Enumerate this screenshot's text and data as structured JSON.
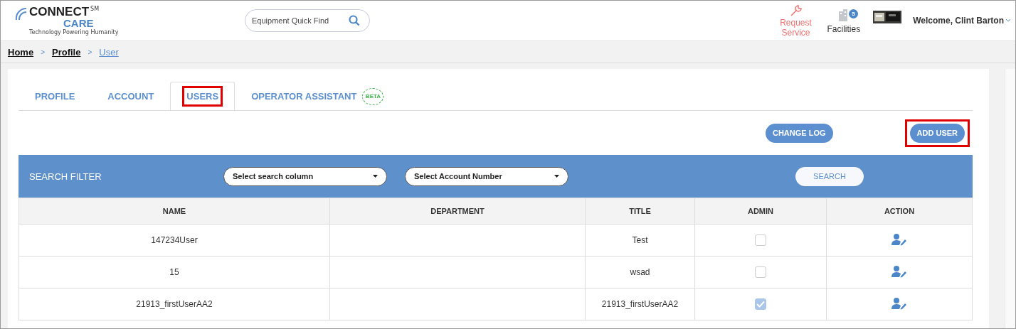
{
  "header": {
    "logo": {
      "mark": "SM",
      "name_top": "CONNECT",
      "name_bottom": "CARE",
      "tagline": "Technology Powering Humanity"
    },
    "quick_find": {
      "placeholder": "Equipment Quick Find"
    },
    "request_service": "Request Service",
    "facilities": {
      "label": "Facilities",
      "count": "5"
    },
    "welcome": "Welcome, Clint Barton"
  },
  "breadcrumb": [
    {
      "label": "Home",
      "current": false
    },
    {
      "label": "Profile",
      "current": false
    },
    {
      "label": "User",
      "current": true
    }
  ],
  "breadcrumb_separator": ">",
  "tabs": [
    {
      "label": "PROFILE",
      "selected": false,
      "highlighted": false
    },
    {
      "label": "ACCOUNT",
      "selected": false,
      "highlighted": false
    },
    {
      "label": "USERS",
      "selected": true,
      "highlighted": true
    },
    {
      "label": "OPERATOR ASSISTANT",
      "selected": false,
      "highlighted": false,
      "badge": "BETA"
    }
  ],
  "actions": [
    {
      "label": "CHANGE LOG",
      "highlighted": false
    },
    {
      "label": "ADD USER",
      "highlighted": true
    }
  ],
  "search_filter": {
    "title": "SEARCH FILTER",
    "selects": [
      "Select search column",
      "Select Account Number"
    ],
    "button": "SEARCH"
  },
  "table": {
    "columns": [
      "NAME",
      "DEPARTMENT",
      "TITLE",
      "ADMIN",
      "ACTION"
    ],
    "rows": [
      {
        "name": "147234User",
        "title": "Test",
        "admin": false
      },
      {
        "name": "15",
        "title": "wsad",
        "admin": false
      },
      {
        "name": "21913_firstUserAA2",
        "title": "21913_firstUserAA2",
        "admin": true
      }
    ]
  }
}
